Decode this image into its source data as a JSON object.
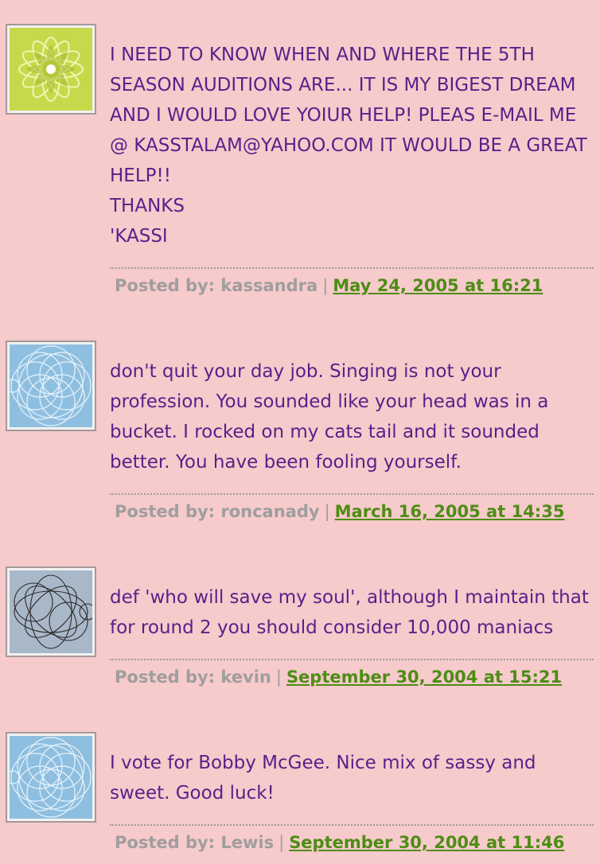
{
  "comments": [
    {
      "body": "I NEED TO KNOW WHEN AND WHERE THE 5TH SEASON AUDITIONS ARE... IT IS MY BIGEST DREAM AND I WOULD LOVE YOIUR HELP! PLEAS E-MAIL ME @ KASSTALAM@YAHOO.COM IT WOULD BE A GREAT HELP!!\nTHANKS\n'KASSI",
      "posted_by_label": "Posted by:",
      "author": "kassandra",
      "separator": "|",
      "timestamp": "May 24, 2005 at 16:21",
      "avatar": "green-flower-icon"
    },
    {
      "body": "don't quit your day job. Singing is not your profession. You sounded like your head was in a bucket. I rocked on my cats tail and it sounded better. You have been fooling yourself.",
      "posted_by_label": "Posted by:",
      "author": "roncanady",
      "separator": "|",
      "timestamp": "March 16, 2005 at 14:35",
      "avatar": "blue-spiro-icon"
    },
    {
      "body": "def 'who will save my soul', although I maintain that for round 2 you should consider 10,000 maniacs",
      "posted_by_label": "Posted by:",
      "author": "kevin",
      "separator": "|",
      "timestamp": "September 30, 2004 at 15:21",
      "avatar": "gray-spiro-icon"
    },
    {
      "body": "I vote for Bobby McGee. Nice mix of sassy and sweet. Good luck!",
      "posted_by_label": "Posted by:",
      "author": "Lewis",
      "separator": "|",
      "timestamp": "September 30, 2004 at 11:46",
      "avatar": "blue-spiro-icon"
    }
  ],
  "colors": {
    "background": "#f7cacb",
    "body_text": "#5a1f8a",
    "meta_text": "#9e9e9e",
    "link": "#4d8d15"
  }
}
